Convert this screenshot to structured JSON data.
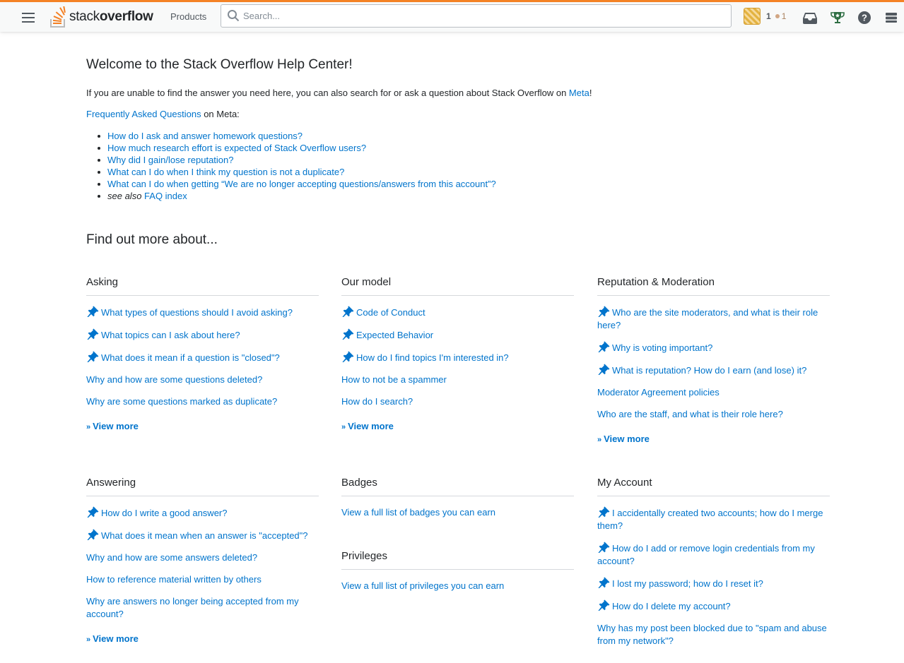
{
  "topbar": {
    "logo_light": "stack",
    "logo_bold": "overflow",
    "products_label": "Products",
    "search_placeholder": "Search...",
    "reputation": "1",
    "bronze_badges": "1",
    "icons": [
      "menu-icon",
      "inbox-icon",
      "achievements-icon",
      "help-icon",
      "site-switcher-icon"
    ]
  },
  "welcome": {
    "title": "Welcome to the Stack Overflow Help Center!",
    "intro_text": "If you are unable to find the answer you need here, you can also search for or ask a question about Stack Overflow on ",
    "intro_link": "Meta",
    "intro_end": "!",
    "faq_link": "Frequently Asked Questions",
    "faq_suffix": " on Meta:",
    "faq_items": [
      "How do I ask and answer homework questions?",
      "How much research effort is expected of Stack Overflow users?",
      "Why did I gain/lose reputation?",
      "What can I do when I think my question is not a duplicate?",
      "What can I do when getting “We are no longer accepting questions/answers from this account”?"
    ],
    "see_also": "see also",
    "faq_index": "FAQ index"
  },
  "find_more_title": "Find out more about...",
  "view_more": "View more",
  "sections": {
    "asking": {
      "title": "Asking",
      "items": [
        {
          "text": "What types of questions should I avoid asking?",
          "pinned": true
        },
        {
          "text": "What topics can I ask about here?",
          "pinned": true
        },
        {
          "text": "What does it mean if a question is \"closed\"?",
          "pinned": true
        },
        {
          "text": "Why and how are some questions deleted?",
          "pinned": false
        },
        {
          "text": "Why are some questions marked as duplicate?",
          "pinned": false
        }
      ]
    },
    "our_model": {
      "title": "Our model",
      "items": [
        {
          "text": "Code of Conduct",
          "pinned": true
        },
        {
          "text": "Expected Behavior",
          "pinned": true
        },
        {
          "text": "How do I find topics I'm interested in?",
          "pinned": true
        },
        {
          "text": "How to not be a spammer",
          "pinned": false
        },
        {
          "text": "How do I search?",
          "pinned": false
        }
      ]
    },
    "reputation": {
      "title": "Reputation & Moderation",
      "items": [
        {
          "text": "Who are the site moderators, and what is their role here?",
          "pinned": true
        },
        {
          "text": "Why is voting important?",
          "pinned": true
        },
        {
          "text": "What is reputation? How do I earn (and lose) it?",
          "pinned": true
        },
        {
          "text": "Moderator Agreement policies",
          "pinned": false
        },
        {
          "text": "Who are the staff, and what is their role here?",
          "pinned": false
        }
      ]
    },
    "answering": {
      "title": "Answering",
      "items": [
        {
          "text": "How do I write a good answer?",
          "pinned": true
        },
        {
          "text": "What does it mean when an answer is \"accepted\"?",
          "pinned": true
        },
        {
          "text": "Why and how are some answers deleted?",
          "pinned": false
        },
        {
          "text": "How to reference material written by others",
          "pinned": false
        },
        {
          "text": "Why are answers no longer being accepted from my account?",
          "pinned": false
        }
      ]
    },
    "badges": {
      "title": "Badges",
      "items": [
        {
          "text": "View a full list of badges you can earn",
          "pinned": false
        }
      ]
    },
    "privileges": {
      "title": "Privileges",
      "items": [
        {
          "text": "View a full list of privileges you can earn",
          "pinned": false
        }
      ]
    },
    "my_account": {
      "title": "My Account",
      "items": [
        {
          "text": "I accidentally created two accounts; how do I merge them?",
          "pinned": true
        },
        {
          "text": "How do I add or remove login credentials from my account?",
          "pinned": true
        },
        {
          "text": "I lost my password; how do I reset it?",
          "pinned": true
        },
        {
          "text": "How do I delete my account?",
          "pinned": true
        },
        {
          "text": "Why has my post been blocked due to \"spam and abuse from my network\"?",
          "pinned": false
        }
      ]
    }
  },
  "colors": {
    "accent": "#f48225",
    "link": "#0074cc",
    "text": "#232629"
  }
}
